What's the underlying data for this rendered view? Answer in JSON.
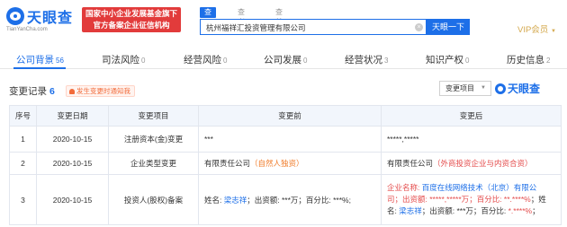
{
  "header": {
    "logo_name": "天眼查",
    "logo_url": "TianYanCha.com",
    "gov_badge_line1": "国家中小企业发展基金旗下",
    "gov_badge_line2": "官方备案企业征信机构",
    "search_tabs": [
      "查公司",
      "查老板",
      "查关系"
    ],
    "search_value": "杭州福祥汇投资管理有限公司",
    "search_button": "天眼一下",
    "vip_label": "VIP会员"
  },
  "nav": {
    "items": [
      {
        "label": "公司背景",
        "count": "56"
      },
      {
        "label": "司法风险",
        "count": "0"
      },
      {
        "label": "经营风险",
        "count": "0"
      },
      {
        "label": "公司发展",
        "count": "0"
      },
      {
        "label": "经营状况",
        "count": "3"
      },
      {
        "label": "知识产权",
        "count": "0"
      },
      {
        "label": "历史信息",
        "count": "2"
      }
    ]
  },
  "section": {
    "title": "变更记录",
    "count": "6",
    "notify": "发生变更时通知我",
    "type_select": "变更项目",
    "brand": "天眼查"
  },
  "table": {
    "headers": [
      "序号",
      "变更日期",
      "变更项目",
      "变更前",
      "变更后"
    ],
    "rows": [
      {
        "index": "1",
        "date": "2020-10-15",
        "item": "注册资本(金)变更",
        "before": "***",
        "after": "*****,*****"
      },
      {
        "index": "2",
        "date": "2020-10-15",
        "item": "企业类型变更",
        "before_main": "有限责任公司",
        "before_note": "（自然人独资）",
        "after_main": "有限责任公司",
        "after_note": "（外商投资企业与内资合资）"
      },
      {
        "index": "3",
        "date": "2020-10-15",
        "item": "投资人(股权)备案",
        "before_name_label": "姓名: ",
        "before_name": "梁志祥",
        "before_rest": "；出资额: ***万；百分比: ***%;",
        "after_l1_label": "企业名称: ",
        "after_l1_name": "百度在线网络技术（北京）有限公",
        "after_l2_prefix": "司；出资额: ",
        "after_l2_amount": "*****,*****万",
        "after_l2_pct_label": "；百分比: ",
        "after_l2_pct": "**.****%",
        "after_l2_tail": "；姓",
        "after_l3_label": "名: ",
        "after_l3_name": "梁志祥",
        "after_l3_rest": "；出资额: ***万；百分比: ",
        "after_l3_pct": "*.****%",
        "after_l3_tail": "；"
      }
    ]
  }
}
